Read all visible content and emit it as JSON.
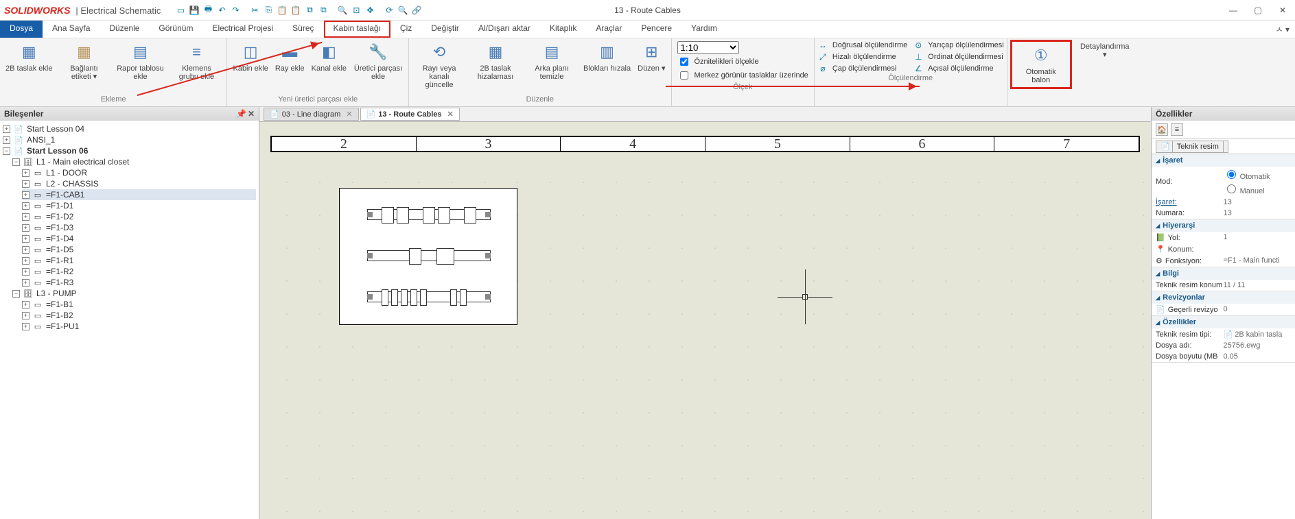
{
  "app": {
    "brand": "SOLIDWORKS",
    "brand_sub": "| Electrical Schematic",
    "window_title": "13 - Route Cables"
  },
  "menu": {
    "file": "Dosya",
    "items": [
      "Ana Sayfa",
      "Düzenle",
      "Görünüm",
      "Electrical Projesi",
      "Süreç",
      "Kabin taslağı",
      "Çiz",
      "Değiştir",
      "Al/Dışarı aktar",
      "Kitaplık",
      "Araçlar",
      "Pencere",
      "Yardım"
    ],
    "highlight_index": 5
  },
  "ribbon": {
    "groups": {
      "ekleme": {
        "label": "Ekleme",
        "buttons": [
          "2B taslak ekle",
          "Bağlantı etiketi ▾",
          "Rapor tablosu ekle",
          "Klemens grubu ekle"
        ]
      },
      "yeni": {
        "label": "Yeni üretici parçası ekle",
        "buttons": [
          "Kabin ekle",
          "Ray ekle",
          "Kanal ekle",
          "Üretici parçası ekle"
        ]
      },
      "duzenle": {
        "label": "Düzenle",
        "buttons": [
          "Rayı veya kanalı güncelle",
          "2B taslak hizalaması",
          "Arka planı temizle",
          "Blokları hızala",
          "Düzen ▾"
        ]
      },
      "olcek": {
        "label": "Ölçek",
        "scale": "1:10",
        "chk1": "Öznitelikleri ölçekle",
        "chk2": "Merkez görünür taslaklar üzerinde"
      },
      "olculendirme": {
        "label": "Ölçülendirme",
        "col1": [
          "Doğrusal ölçülendirme",
          "Hizalı ölçülendirme",
          "Çap ölçülendirmesi"
        ],
        "col2": [
          "Yarıçap ölçülendirmesi",
          "Ordinat ölçülendirmesi",
          "Açısal ölçülendirme"
        ]
      },
      "balon": {
        "label": "Otomatik balon"
      },
      "detay": {
        "label": "Detaylandırma ▾"
      }
    }
  },
  "left_panel": {
    "title": "Bileşenler",
    "tree": [
      {
        "d": 0,
        "exp": "+",
        "ico": "📄",
        "lbl": "Start Lesson 04"
      },
      {
        "d": 0,
        "exp": "+",
        "ico": "📄",
        "lbl": "ANSI_1"
      },
      {
        "d": 0,
        "exp": "−",
        "ico": "📄",
        "lbl": "Start Lesson 06",
        "bold": true
      },
      {
        "d": 1,
        "exp": "−",
        "ico": "🗄",
        "lbl": "L1 - Main electrical closet"
      },
      {
        "d": 2,
        "exp": "+",
        "ico": "▭",
        "lbl": "L1 - DOOR"
      },
      {
        "d": 2,
        "exp": "+",
        "ico": "▭",
        "lbl": "L2 - CHASSIS"
      },
      {
        "d": 2,
        "exp": "+",
        "ico": "▭",
        "lbl": "=F1-CAB1",
        "sel": true
      },
      {
        "d": 2,
        "exp": "+",
        "ico": "▭",
        "lbl": "=F1-D1"
      },
      {
        "d": 2,
        "exp": "+",
        "ico": "▭",
        "lbl": "=F1-D2"
      },
      {
        "d": 2,
        "exp": "+",
        "ico": "▭",
        "lbl": "=F1-D3"
      },
      {
        "d": 2,
        "exp": "+",
        "ico": "▭",
        "lbl": "=F1-D4"
      },
      {
        "d": 2,
        "exp": "+",
        "ico": "▭",
        "lbl": "=F1-D5"
      },
      {
        "d": 2,
        "exp": "+",
        "ico": "▭",
        "lbl": "=F1-R1"
      },
      {
        "d": 2,
        "exp": "+",
        "ico": "▭",
        "lbl": "=F1-R2"
      },
      {
        "d": 2,
        "exp": "+",
        "ico": "▭",
        "lbl": "=F1-R3"
      },
      {
        "d": 1,
        "exp": "−",
        "ico": "🗄",
        "lbl": "L3 - PUMP"
      },
      {
        "d": 2,
        "exp": "+",
        "ico": "▭",
        "lbl": "=F1-B1"
      },
      {
        "d": 2,
        "exp": "+",
        "ico": "▭",
        "lbl": "=F1-B2"
      },
      {
        "d": 2,
        "exp": "+",
        "ico": "▭",
        "lbl": "=F1-PU1"
      }
    ]
  },
  "doctabs": [
    {
      "label": "03 - Line diagram",
      "active": false
    },
    {
      "label": "13 - Route Cables",
      "active": true
    }
  ],
  "ruler": [
    "2",
    "3",
    "4",
    "5",
    "6",
    "7"
  ],
  "right_panel": {
    "title": "Özellikler",
    "subtab": "Teknik resim",
    "sections": {
      "isaret": {
        "title": "İşaret",
        "mod_label": "Mod:",
        "mod_options": [
          "Otomatik",
          "Manuel"
        ],
        "isaret_label": "İşaret:",
        "isaret_value": "13",
        "numara_label": "Numara:",
        "numara_value": "13"
      },
      "hiyerarsi": {
        "title": "Hiyerarşi",
        "yol_label": "Yol:",
        "yol_value": "1",
        "konum_label": "Konum:",
        "fonksiyon_label": "Fonksiyon:",
        "fonksiyon_value": "=F1 - Main functi"
      },
      "bilgi": {
        "title": "Bilgi",
        "konum_label": "Teknik resim konum",
        "konum_value": "11 / 11"
      },
      "revizyon": {
        "title": "Revizyonlar",
        "current_label": "Geçerli revizyo",
        "current_value": "0"
      },
      "ozellikler": {
        "title": "Özellikler",
        "tip_label": "Teknik resim tipi:",
        "tip_value": "2B kabin tasla",
        "dosya_label": "Dosya adı:",
        "dosya_value": "25756.ewg",
        "boyut_label": "Dosya boyutu (MB",
        "boyut_value": "0.05"
      }
    }
  }
}
